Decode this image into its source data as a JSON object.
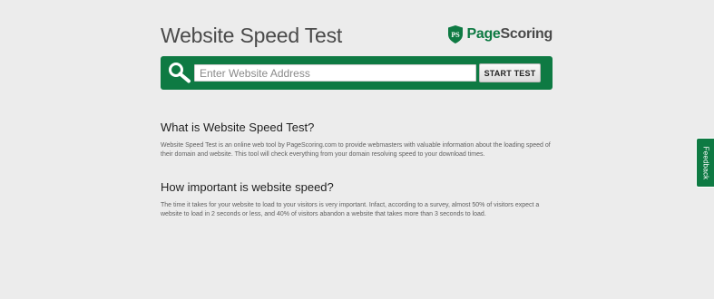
{
  "header": {
    "title": "Website Speed Test",
    "logo": {
      "badge_text": "PS",
      "name_part1": "Page",
      "name_part2": "Scoring"
    }
  },
  "search": {
    "placeholder": "Enter Website Address",
    "value": "",
    "button_label": "START TEST",
    "icon": "search-icon"
  },
  "sections": [
    {
      "heading": "What is Website Speed Test?",
      "body": "Website Speed Test is an online web tool by PageScoring.com to provide webmasters with valuable information about the loading speed of their domain and website. This tool will check everything from your domain resolving speed to your download times."
    },
    {
      "heading": "How important is website speed?",
      "body": "The time it takes for your website to load to your visitors is very important. Infact, according to a survey, almost 50% of visitors expect a website to load in 2 seconds or less, and 40% of visitors abandon a website that takes more than 3 seconds to load."
    }
  ],
  "feedback": {
    "label": "Feedback"
  },
  "colors": {
    "brand_green": "#0e7a43",
    "background": "#ececec",
    "title_gray": "#4a4a4a"
  }
}
